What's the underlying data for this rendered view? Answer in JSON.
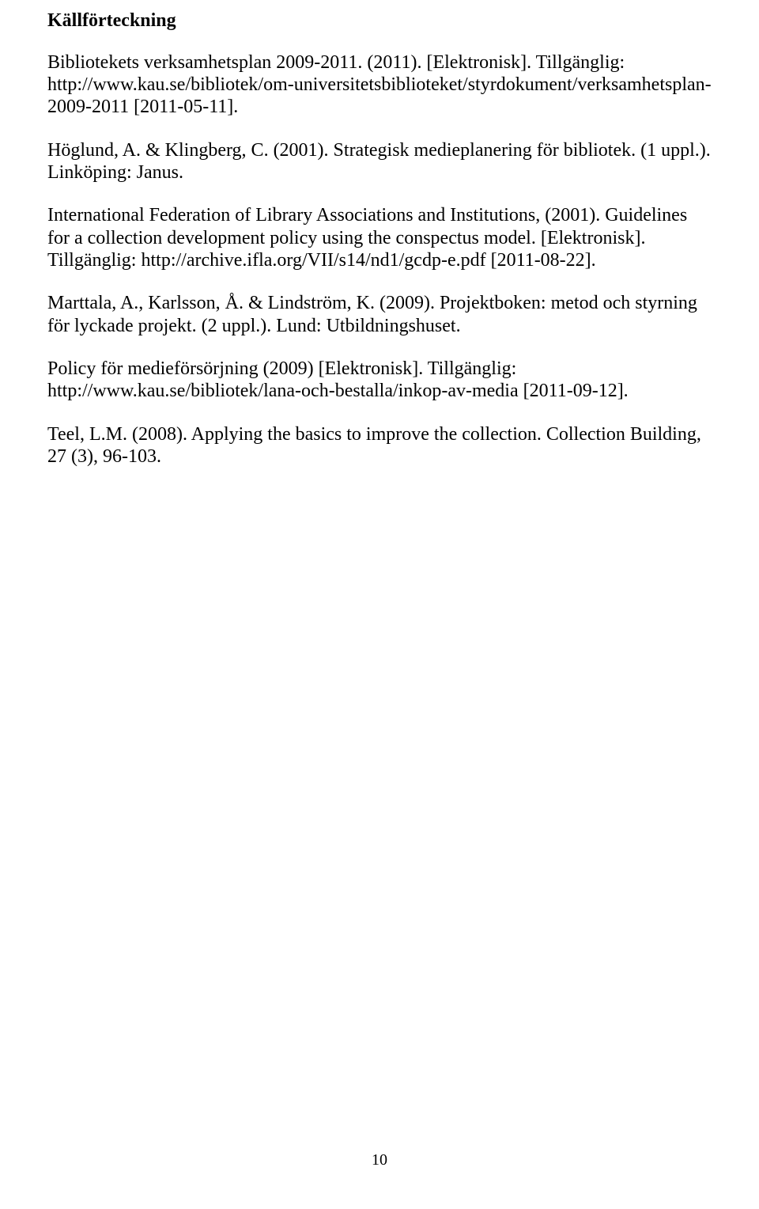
{
  "heading": "Källförteckning",
  "entries": [
    "Bibliotekets verksamhetsplan 2009-2011. (2011). [Elektronisk]. Tillgänglig: http://www.kau.se/bibliotek/om-universitetsbiblioteket/styrdokument/verksamhetsplan-2009-2011 [2011-05-11].",
    "Höglund, A. & Klingberg, C. (2001). Strategisk medieplanering för bibliotek. (1 uppl.). Linköping: Janus.",
    "International Federation of Library Associations and Institutions, (2001). Guidelines for a collection development policy using the conspectus model. [Elektronisk]. Tillgänglig: http://archive.ifla.org/VII/s14/nd1/gcdp-e.pdf [2011-08-22].",
    "Marttala, A., Karlsson, Å. & Lindström, K. (2009). Projektboken: metod och styrning för lyckade projekt. (2 uppl.). Lund: Utbildningshuset.",
    "Policy för medieförsörjning (2009) [Elektronisk]. Tillgänglig: http://www.kau.se/bibliotek/lana-och-bestalla/inkop-av-media [2011-09-12].",
    "Teel, L.M. (2008). Applying the basics to improve the collection. Collection Building, 27 (3), 96-103."
  ],
  "page_number": "10"
}
